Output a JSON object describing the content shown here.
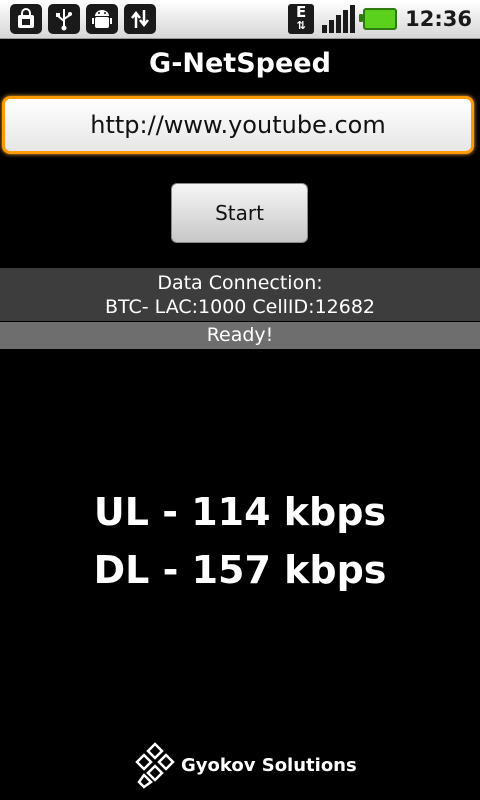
{
  "statusbar": {
    "left_icons": [
      "shopping-bag-icon",
      "usb-icon",
      "android-debug-icon",
      "data-transfer-icon"
    ],
    "network_type": "E",
    "clock": "12:36",
    "battery_color": "#5bd11d"
  },
  "app": {
    "title": "G-NetSpeed",
    "url_value": "http://www.youtube.com",
    "start_label": "Start",
    "connection": {
      "line1": "Data Connection:",
      "line2": "BTC- LAC:1000 CellID:12682"
    },
    "status": "Ready!",
    "ul_text": "UL - 114 kbps",
    "dl_text": "DL - 157 kbps",
    "footer_brand": "Gyokov Solutions",
    "accent": "#ff9a00"
  }
}
